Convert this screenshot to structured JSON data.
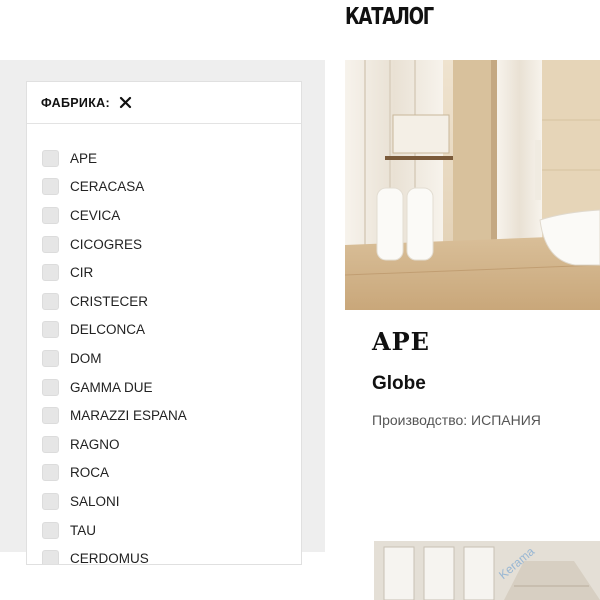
{
  "catalog": {
    "title": "КАТАЛОГ"
  },
  "filter": {
    "title": "ФАБРИКА:",
    "clear_icon": "close-icon",
    "brands": [
      {
        "label": "APE",
        "checked": false
      },
      {
        "label": "CERACASA",
        "checked": false
      },
      {
        "label": "CEVICA",
        "checked": false
      },
      {
        "label": "CICOGRES",
        "checked": false
      },
      {
        "label": "CIR",
        "checked": false
      },
      {
        "label": "CRISTECER",
        "checked": false
      },
      {
        "label": "DELCONCA",
        "checked": false
      },
      {
        "label": "DOM",
        "checked": false
      },
      {
        "label": "GAMMA DUE",
        "checked": false
      },
      {
        "label": "MARAZZI ESPANA",
        "checked": false
      },
      {
        "label": "RAGNO",
        "checked": false
      },
      {
        "label": "ROCA",
        "checked": false
      },
      {
        "label": "SALONI",
        "checked": false
      },
      {
        "label": "TAU",
        "checked": false
      },
      {
        "label": "CERDOMUS",
        "checked": false
      }
    ]
  },
  "product": {
    "brand": "APE",
    "collection": "Globe",
    "origin": "Производство: ИСПАНИЯ"
  },
  "watermark": "Kerama",
  "colors": {
    "sidebar_bg": "#eeeeee",
    "checkbox_fill": "#e6e6e6",
    "text": "#111111"
  }
}
